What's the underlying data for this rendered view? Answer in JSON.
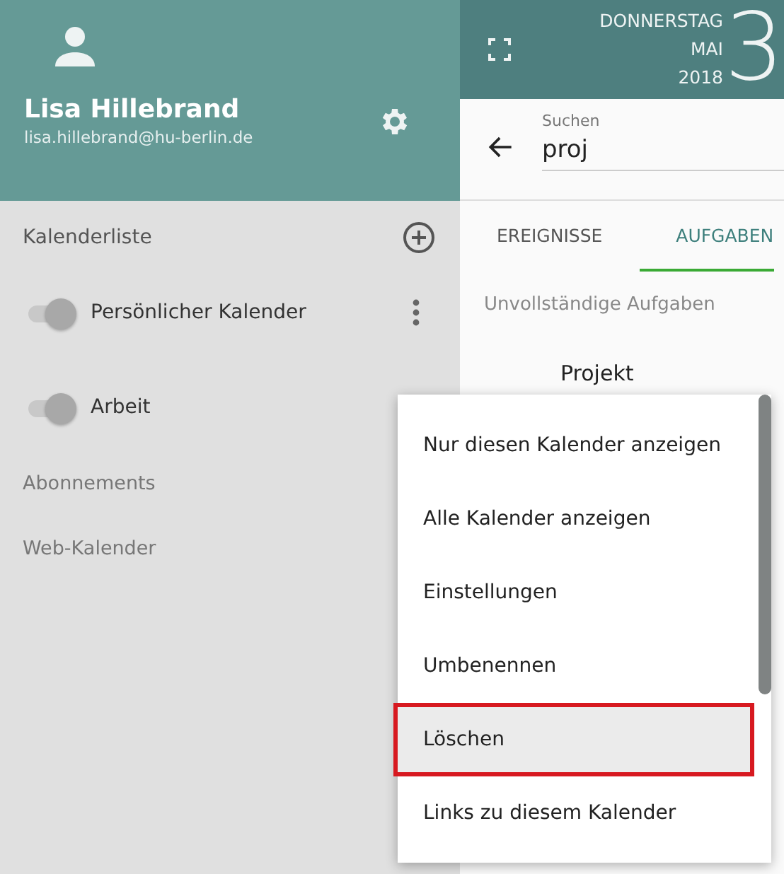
{
  "profile": {
    "name": "Lisa Hillebrand",
    "email": "lisa.hillebrand@hu-berlin.de"
  },
  "calendar_list": {
    "title": "Kalenderliste",
    "calendars": [
      {
        "name": "Persönlicher Kalender",
        "on": false,
        "has_menu": true
      },
      {
        "name": "Arbeit",
        "on": false,
        "has_menu": false
      }
    ]
  },
  "sections": [
    "Abonnements",
    "Web-Kalender"
  ],
  "date": {
    "weekday": "DONNERSTAG",
    "month": "MAI",
    "year": "2018",
    "day": "3"
  },
  "search": {
    "label": "Suchen",
    "value": "proj"
  },
  "tabs": [
    {
      "label": "EREIGNISSE",
      "selected": false
    },
    {
      "label": "AUFGABEN",
      "selected": true
    }
  ],
  "tasks": {
    "heading": "Unvollständige Aufgaben",
    "items": [
      "Projekt"
    ]
  },
  "context_menu": {
    "items": [
      {
        "label": "Nur diesen Kalender anzeigen",
        "selected": false
      },
      {
        "label": "Alle Kalender anzeigen",
        "selected": false
      },
      {
        "label": "Einstellungen",
        "selected": false
      },
      {
        "label": "Umbenennen",
        "selected": false
      },
      {
        "label": "Löschen",
        "selected": true
      },
      {
        "label": "Links zu diesem Kalender",
        "selected": false
      }
    ]
  }
}
